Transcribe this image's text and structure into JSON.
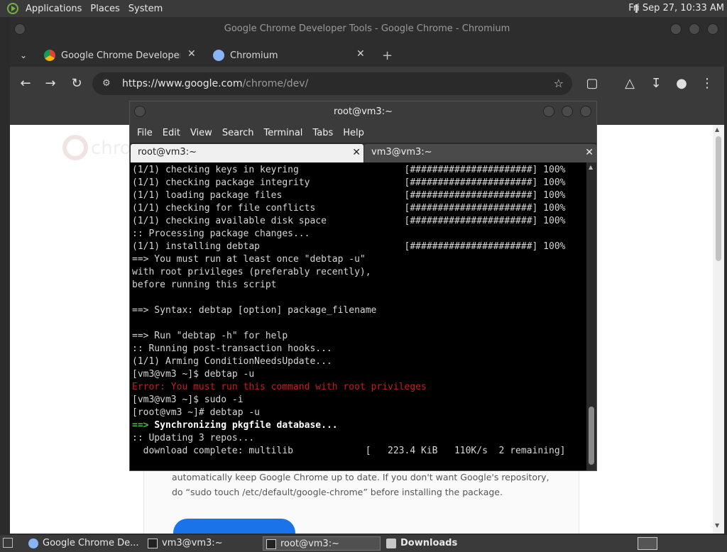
{
  "top_panel": {
    "menus": [
      "Applications",
      "Places",
      "System"
    ],
    "clock": "Fri Sep 27, 10:33 AM"
  },
  "chrome": {
    "window_title": "Google Chrome Developer Tools - Google Chrome - Chromium",
    "tabs": [
      {
        "label": "Google Chrome Developer T"
      },
      {
        "label": "Chromium"
      }
    ],
    "new_tab": "+",
    "url_host": "https://www.google.com",
    "url_path": "/chrome/dev/",
    "page_paragraph": "automatically keep Google Chrome up to date. If you don't want Google's repository, do “sudo touch /etc/default/google-chrome” before installing the package.",
    "ghost_brand": "chro"
  },
  "terminal": {
    "window_title": "root@vm3:~",
    "menus": [
      "File",
      "Edit",
      "View",
      "Search",
      "Terminal",
      "Tabs",
      "Help"
    ],
    "tabs": [
      {
        "label": "root@vm3:~"
      },
      {
        "label": "vm3@vm3:~"
      }
    ],
    "lines": [
      "(1/1) checking keys in keyring                   [######################] 100%",
      "(1/1) checking package integrity                 [######################] 100%",
      "(1/1) loading package files                      [######################] 100%",
      "(1/1) checking for file conflicts                [######################] 100%",
      "(1/1) checking available disk space              [######################] 100%",
      ":: Processing package changes...",
      "(1/1) installing debtap                          [######################] 100%",
      "==> You must run at least once \"debtap -u\"",
      "with root privileges (preferably recently),",
      "before running this script",
      "",
      "==> Syntax: debtap [option] package_filename",
      "",
      "==> Run \"debtap -h\" for help",
      ":: Running post-transaction hooks...",
      "(1/1) Arming ConditionNeedsUpdate...",
      "[vm3@vm3 ~]$ debtap -u",
      "Error: You must run this command with root privileges",
      "[vm3@vm3 ~]$ sudo -i",
      "[root@vm3 ~]# debtap -u",
      "Synchronizing pkgfile database...",
      ":: Updating 3 repos...",
      "  download complete: multilib             [   223.4 KiB   110K/s  2 remaining]"
    ],
    "sync_prefix": "==> "
  },
  "taskbar": {
    "items": [
      {
        "label": "Google Chrome De..."
      },
      {
        "label": "vm3@vm3:~"
      },
      {
        "label": "root@vm3:~"
      },
      {
        "label": "Downloads"
      }
    ]
  },
  "colors": {
    "terminal_error": "#c0201c",
    "terminal_prompt_green": "#3ec63e",
    "link_blue": "#1a73e8"
  }
}
